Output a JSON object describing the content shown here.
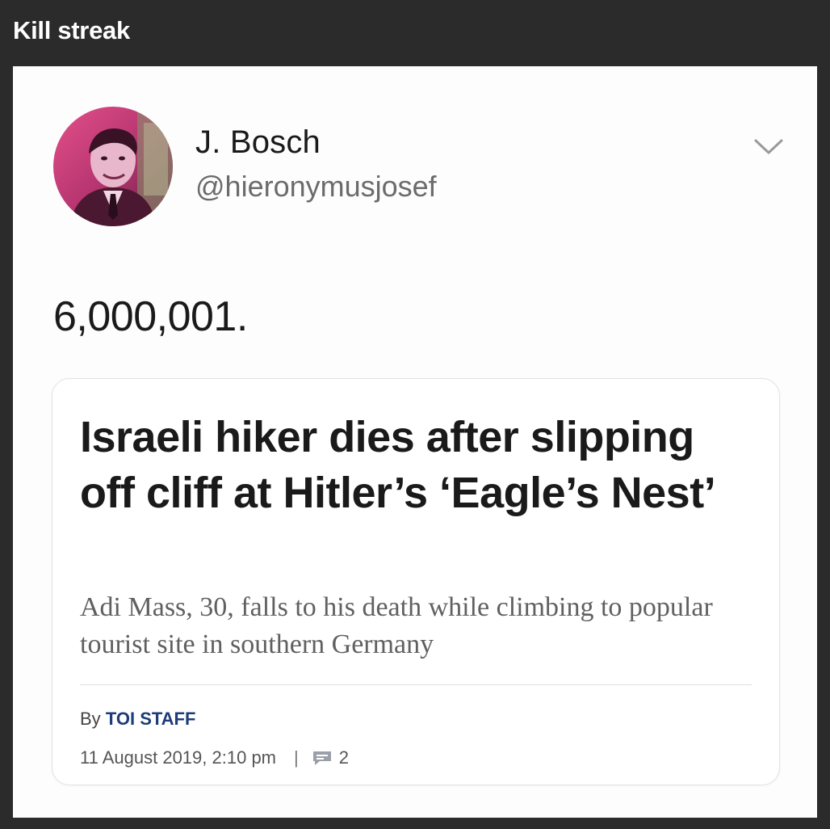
{
  "post": {
    "title": "Kill streak"
  },
  "tweet": {
    "display_name": "J. Bosch",
    "handle": "@hieronymusjosef",
    "text": "6,000,001.",
    "menu_icon": "chevron-down-icon",
    "avatar_icon": "avatar"
  },
  "article_card": {
    "headline": "Israeli hiker dies after slipping off cliff at Hitler’s ‘Eagle’s Nest’",
    "subhead": "Adi Mass, 30, falls to his death while climbing to popular tourist site in southern Germany",
    "byline_prefix": "By",
    "author": "TOI STAFF",
    "date": "11 August 2019, 2:10 pm",
    "separator": "|",
    "comment_count": "2",
    "comment_icon": "comment-icon"
  },
  "colors": {
    "background": "#2b2b2b",
    "author_link": "#1d3c78"
  }
}
